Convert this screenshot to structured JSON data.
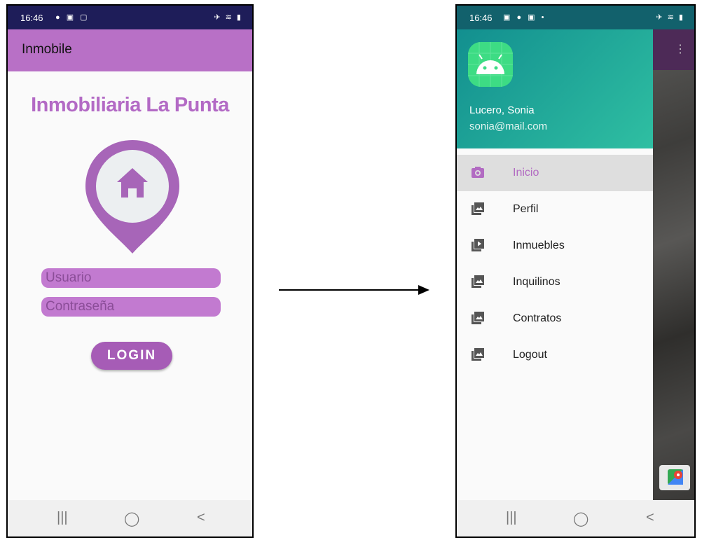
{
  "colors": {
    "accent": "#b870c6",
    "brand": "#b36ac5",
    "field": "#c27ad0",
    "button": "#a65cb6",
    "drawer_header": "#1aa596"
  },
  "login_screen": {
    "status_time": "16:46",
    "app_title": "Inmobile",
    "brand_title": "Inmobiliaria La Punta",
    "logo_icon": "home-pin-icon",
    "username_placeholder": "Usuario",
    "password_placeholder": "Contraseña",
    "login_label": "LOGIN"
  },
  "nav_buttons": {
    "recents": "|||",
    "home": "◯",
    "back": "<"
  },
  "drawer_screen": {
    "status_time": "16:46",
    "user_name": "Lucero, Sonia",
    "user_email": "sonia@mail.com",
    "avatar_icon": "android-icon",
    "menu": [
      {
        "label": "Inicio",
        "icon": "camera-icon",
        "active": true
      },
      {
        "label": "Perfil",
        "icon": "gallery-icon"
      },
      {
        "label": "Inmuebles",
        "icon": "play-icon"
      },
      {
        "label": "Inquilinos",
        "icon": "gallery-icon"
      },
      {
        "label": "Contratos",
        "icon": "gallery-icon"
      },
      {
        "label": "Logout",
        "icon": "gallery-icon"
      }
    ]
  }
}
